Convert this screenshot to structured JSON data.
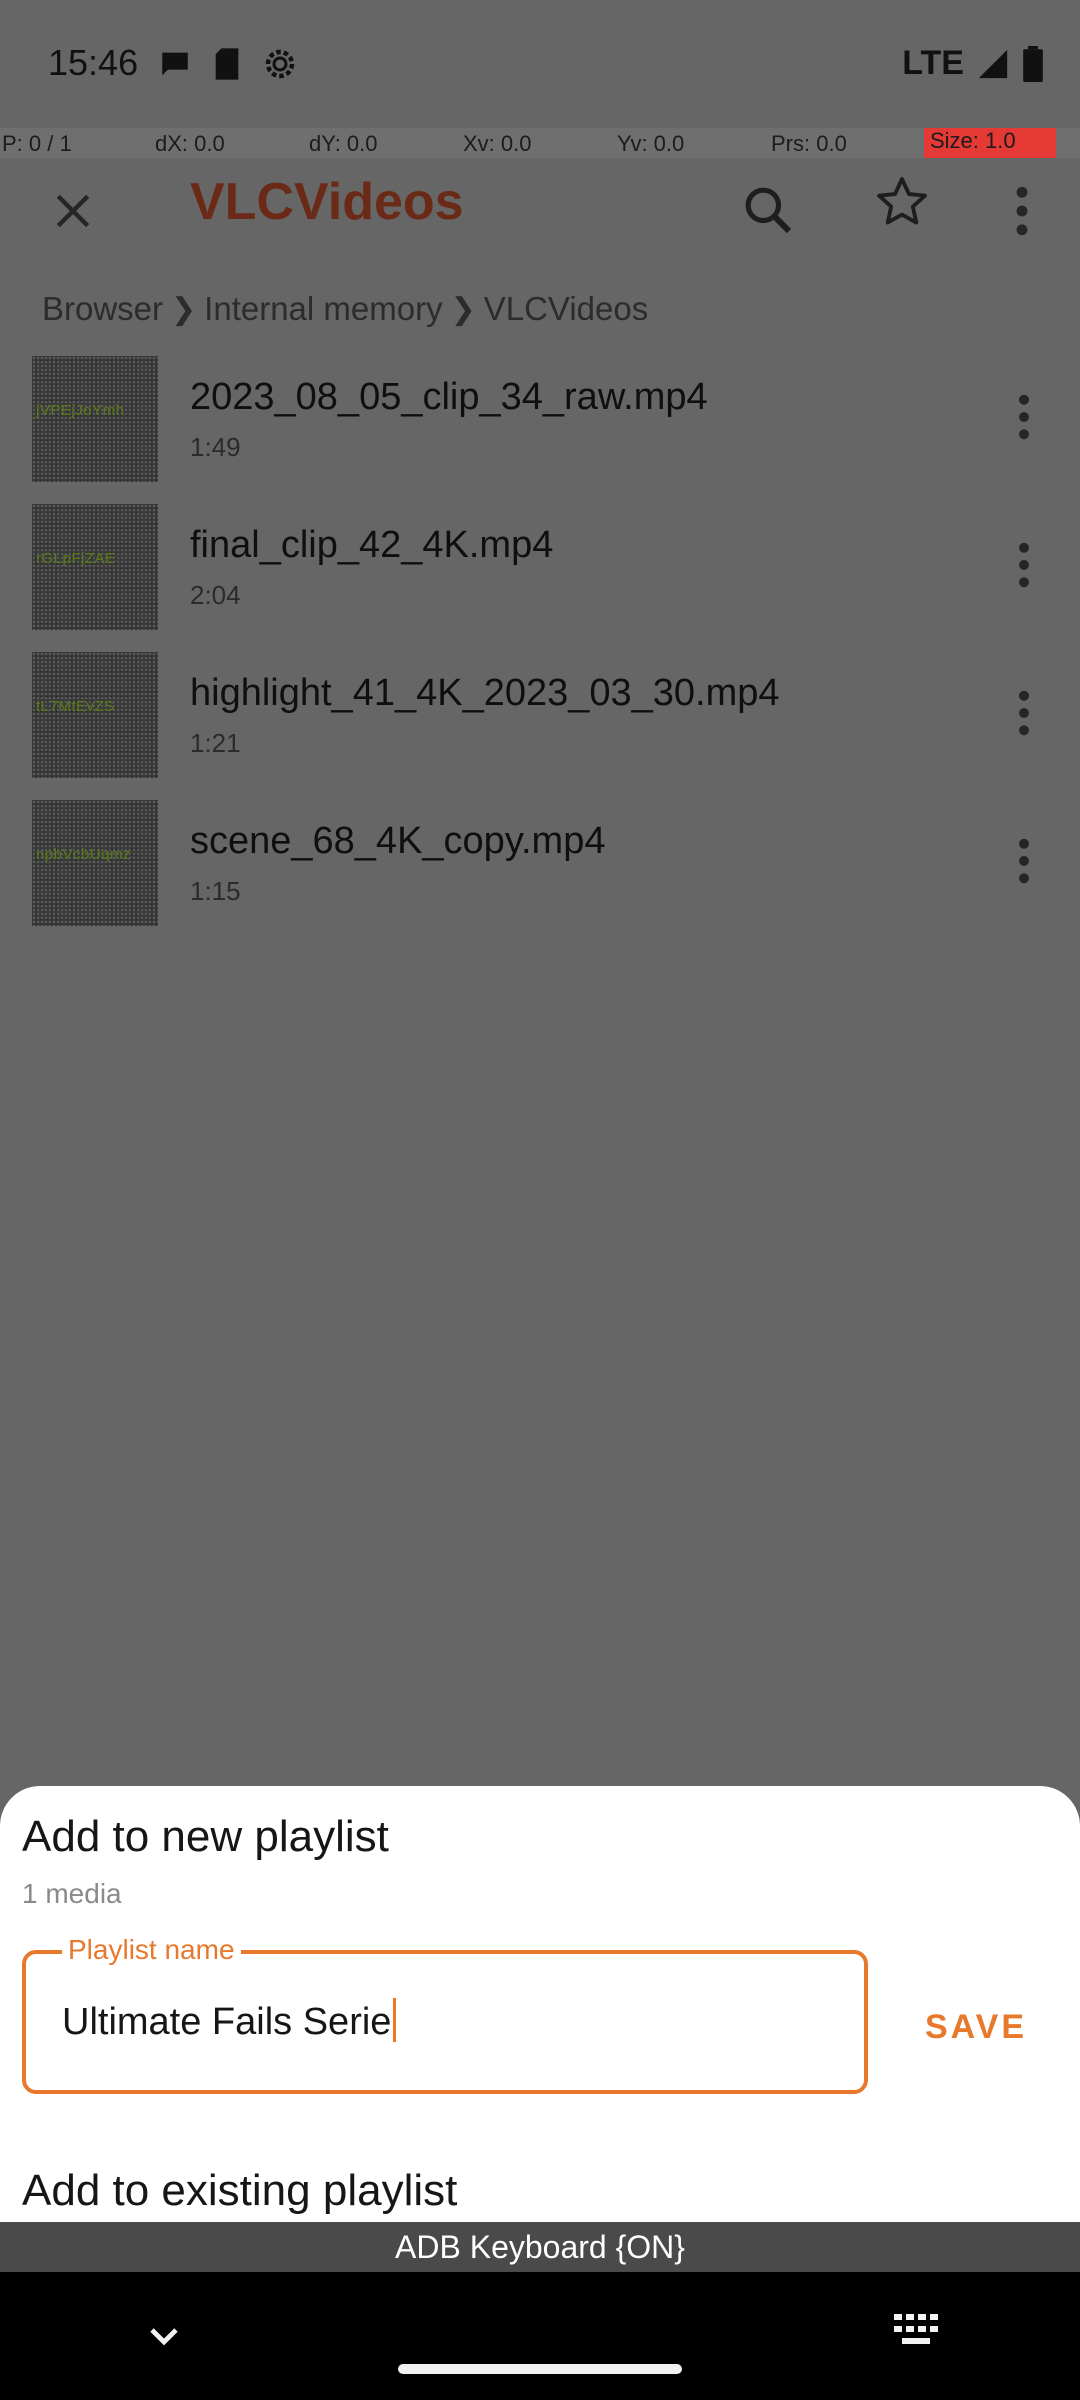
{
  "status_bar": {
    "time": "15:46",
    "network": "LTE",
    "icons": [
      "message-icon",
      "sd-card-icon",
      "settings-gear-icon",
      "signal-icon",
      "battery-icon"
    ]
  },
  "debug_bar": {
    "pointer": "P: 0 / 1",
    "dx": "dX: 0.0",
    "dy": "dY: 0.0",
    "xv": "Xv: 0.0",
    "yv": "Yv: 0.0",
    "prs": "Prs: 0.0",
    "size": "Size: 1.0"
  },
  "toolbar": {
    "title": "VLCVideos",
    "icons": [
      "close-icon",
      "search-icon",
      "star-icon",
      "more-vert-icon"
    ]
  },
  "breadcrumb": [
    "Browser",
    "Internal memory",
    "VLCVideos"
  ],
  "files": [
    {
      "name": "2023_08_05_clip_34_raw.mp4",
      "duration": "1:49",
      "thumb_code": "jVPEjJoYmh"
    },
    {
      "name": "final_clip_42_4K.mp4",
      "duration": "2:04",
      "thumb_code": "rGLpFjZAE"
    },
    {
      "name": "highlight_41_4K_2023_03_30.mp4",
      "duration": "1:21",
      "thumb_code": "tL7MtEvZS"
    },
    {
      "name": "scene_68_4K_copy.mp4",
      "duration": "1:15",
      "thumb_code": "npbVcbUqmz"
    }
  ],
  "sheet": {
    "title": "Add to new playlist",
    "subtitle": "1 media",
    "field_label": "Playlist name",
    "field_value": "Ultimate Fails Serie",
    "save_label": "SAVE",
    "existing_label": "Add to existing playlist"
  },
  "keyboard_indicator": "ADB Keyboard {ON}",
  "colors": {
    "accent": "#e8792c",
    "scrim": "#666666",
    "sheet_bg": "#ffffff",
    "title_text": "#6b2a17"
  }
}
